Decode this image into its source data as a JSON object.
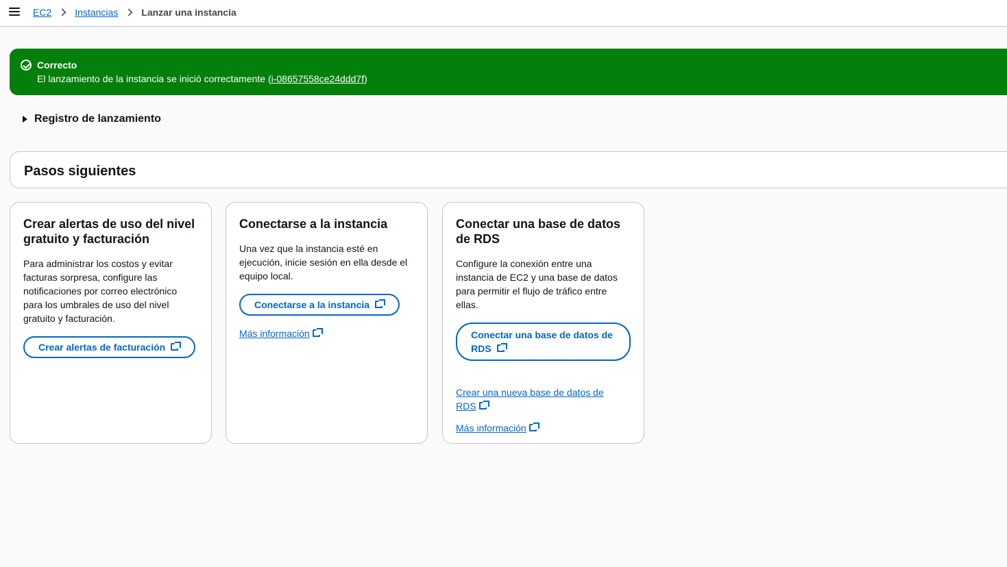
{
  "breadcrumb": {
    "items": [
      "EC2",
      "Instancias"
    ],
    "current": "Lanzar una instancia"
  },
  "flash": {
    "status": "success",
    "color": "#037f0c",
    "title": "Correcto",
    "message_prefix": "El lanzamiento de la instancia se inició correctamente (",
    "instance_id": "i-08657558ce24ddd7f",
    "message_suffix": ")"
  },
  "launch_log": {
    "label": "Registro de lanzamiento"
  },
  "next_steps": {
    "title": "Pasos siguientes",
    "cards": [
      {
        "title": "Crear alertas de uso del nivel gratuito y facturación",
        "description": "Para administrar los costos y evitar facturas sorpresa, configure las notificaciones por correo electrónico para los umbrales de uso del nivel gratuito y facturación.",
        "button": "Crear alertas de facturación"
      },
      {
        "title": "Conectarse a la instancia",
        "description": "Una vez que la instancia esté en ejecución, inicie sesión en ella desde el equipo local.",
        "button": "Conectarse a la instancia",
        "link": "Más información"
      },
      {
        "title": "Conectar una base de datos de RDS",
        "description": "Configure la conexión entre una instancia de EC2 y una base de datos para permitir el flujo de tráfico entre ellas.",
        "button": "Conectar una base de datos de RDS",
        "link_create": "Crear una nueva base de datos de RDS",
        "link": "Más información"
      }
    ]
  },
  "colors": {
    "accent": "#0066cc",
    "success": "#037f0c"
  }
}
